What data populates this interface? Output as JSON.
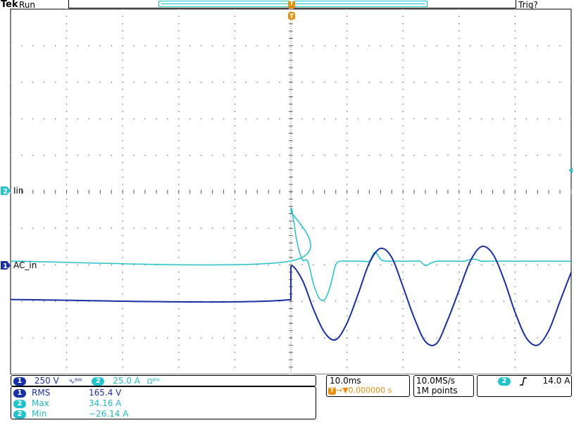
{
  "header": {
    "brand": "Tek",
    "run_state": "Run",
    "trigger_state": "Trig?",
    "trigger_marker": "T"
  },
  "channels": {
    "ch1": {
      "number": "1",
      "name": "AC_in",
      "scale": "250 V",
      "coupling_icon": "∿ᴮᵂ",
      "color": "#1a2fa3"
    },
    "ch2": {
      "number": "2",
      "name": "Iin",
      "scale": "25.0 A",
      "coupling_icon": "Ωᴮᵂ",
      "color": "#22c2cc"
    }
  },
  "measurements": [
    {
      "channel": "1",
      "label": "RMS",
      "value": "165.4 V"
    },
    {
      "channel": "2",
      "label": "Max",
      "value": "34.16 A"
    },
    {
      "channel": "2",
      "label": "Min",
      "value": "−26.14 A"
    }
  ],
  "timebase": {
    "scale": "10.0ms",
    "trigger_position": "▼0.000000 s",
    "sample_rate": "10.0MS/s",
    "record_length": "1M points"
  },
  "trigger": {
    "source": "2",
    "slope_icon": "rising-edge",
    "level": "14.0 A"
  },
  "chart_data": {
    "type": "line",
    "xlabel": "",
    "ylabel": "",
    "x_divisions": 10,
    "y_divisions": 10,
    "grid": true,
    "series": [
      {
        "name": "Iin",
        "channel": "2",
        "color": "#22c2cc",
        "x_div": [
          0,
          4.98,
          5.0,
          5.05,
          5.1,
          5.2,
          5.3,
          5.4,
          5.5,
          5.6,
          5.7,
          5.8,
          5.9,
          6.0,
          6.1,
          6.2,
          6.3,
          6.4,
          6.5,
          6.6,
          6.7,
          6.8,
          6.9,
          7.0,
          7.1,
          7.2,
          7.3,
          7.4,
          7.5,
          7.6,
          7.7,
          7.8,
          7.9,
          8.0,
          8.1,
          8.2,
          8.3,
          8.4,
          8.5,
          8.6,
          8.7,
          8.8,
          8.9,
          9.0,
          9.1,
          9.2,
          9.3,
          9.4,
          9.5,
          9.6,
          9.7,
          9.8,
          9.9,
          10.0
        ],
        "y_div": [
          0,
          0,
          1.4,
          1.1,
          0.6,
          0.05,
          0,
          -0.6,
          -1.0,
          -1.05,
          -0.7,
          -0.1,
          0,
          0,
          0,
          0,
          0,
          0,
          0.25,
          0.05,
          0,
          0,
          0,
          0,
          0,
          0,
          0,
          -0.12,
          -0.05,
          0,
          0,
          0,
          0,
          0,
          0,
          0.05,
          0.05,
          0,
          0,
          0,
          0,
          0,
          0,
          0,
          0,
          0,
          0,
          0,
          0,
          0,
          0,
          0,
          0,
          0
        ]
      },
      {
        "name": "AC_in",
        "channel": "1",
        "color": "#1a2fa3",
        "x_div": [
          0,
          5.0,
          5.0,
          5.2,
          5.4,
          5.6,
          5.8,
          6.0,
          6.2,
          6.4,
          6.6,
          6.8,
          7.0,
          7.2,
          7.4,
          7.6,
          7.8,
          8.0,
          8.2,
          8.4,
          8.6,
          8.8,
          9.0,
          9.2,
          9.4,
          9.6,
          9.8,
          10.0
        ],
        "y_div": [
          -0.05,
          -0.05,
          0.85,
          0.5,
          -0.3,
          -0.95,
          -1.15,
          -0.7,
          0.1,
          0.95,
          1.35,
          1.1,
          0.3,
          -0.55,
          -1.2,
          -1.25,
          -0.6,
          0.2,
          1.0,
          1.4,
          1.2,
          0.5,
          -0.4,
          -1.1,
          -1.3,
          -0.9,
          -0.1,
          0.7
        ]
      }
    ],
    "ch2_ground_div": -1.9,
    "ch1_ground_div": -2.9
  }
}
